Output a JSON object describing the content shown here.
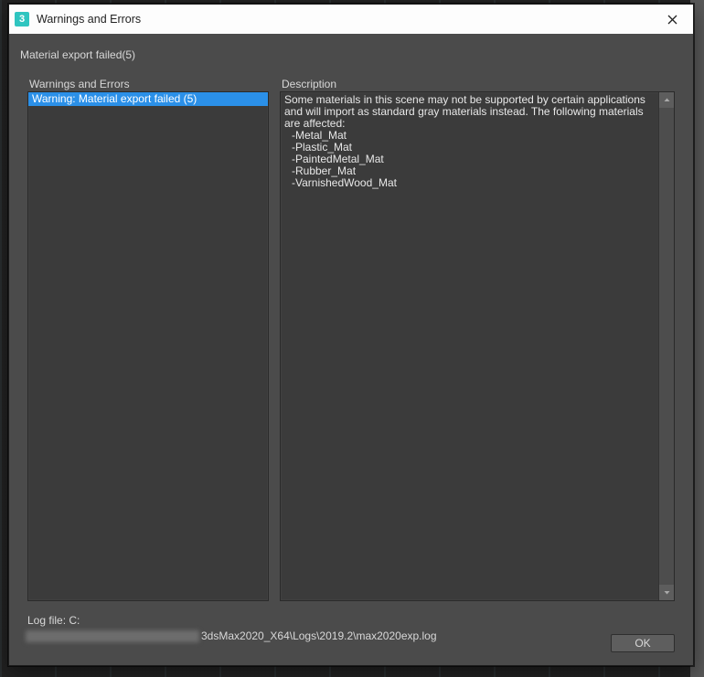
{
  "window": {
    "title": "Warnings and Errors",
    "app_icon_glyph": "3"
  },
  "subtitle": "Material export failed(5)",
  "panels": {
    "left_label": "Warnings and Errors",
    "right_label": "Description"
  },
  "warnings_list": [
    {
      "text": "Warning: Material export failed (5)",
      "selected": true
    }
  ],
  "description": {
    "intro": "Some materials in this scene may not be supported by certain applications and will import as standard gray materials instead. The following materials are affected:",
    "materials": [
      "Metal_Mat",
      "Plastic_Mat",
      "PaintedMetal_Mat",
      "Rubber_Mat",
      "VarnishedWood_Mat"
    ]
  },
  "footer": {
    "log_label": "Log file: C:",
    "log_path_visible": "3dsMax2020_X64\\Logs\\2019.2\\max2020exp.log",
    "ok_label": "OK"
  }
}
